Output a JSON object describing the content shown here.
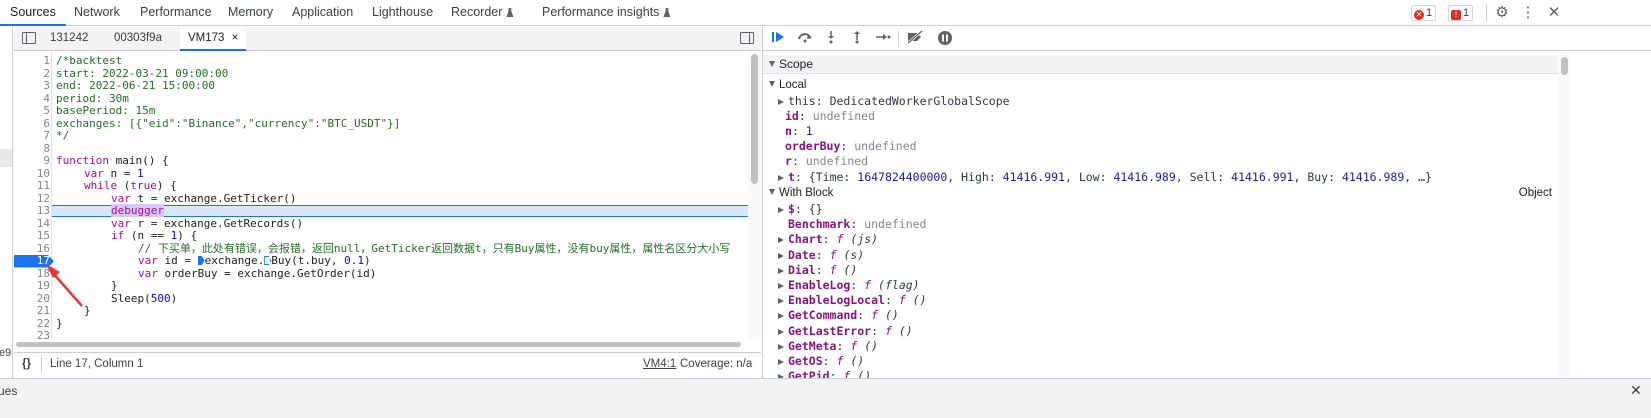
{
  "top_tabs": [
    {
      "label": "Sources",
      "active": true
    },
    {
      "label": "Network",
      "active": false
    },
    {
      "label": "Performance",
      "active": false
    },
    {
      "label": "Memory",
      "active": false
    },
    {
      "label": "Application",
      "active": false
    },
    {
      "label": "Lighthouse",
      "active": false
    },
    {
      "label": "Recorder",
      "active": false,
      "icon": "flask-icon"
    },
    {
      "label": "Performance insights",
      "active": false,
      "icon": "flask-icon"
    }
  ],
  "badges": {
    "errors": "1",
    "issues": "1"
  },
  "file_tabs": [
    {
      "label": "131242"
    },
    {
      "label": "00303f9a"
    },
    {
      "label": "VM173",
      "active": true,
      "close": "×"
    }
  ],
  "code_lines": [
    {
      "n": "1"
    },
    {
      "n": "2"
    },
    {
      "n": "3"
    },
    {
      "n": "4"
    },
    {
      "n": "5"
    },
    {
      "n": "6"
    },
    {
      "n": "7"
    },
    {
      "n": "8"
    },
    {
      "n": "9"
    },
    {
      "n": "10"
    },
    {
      "n": "11"
    },
    {
      "n": "12"
    },
    {
      "n": "13"
    },
    {
      "n": "14"
    },
    {
      "n": "15"
    },
    {
      "n": "16"
    },
    {
      "n": "17"
    },
    {
      "n": "18"
    },
    {
      "n": "19"
    },
    {
      "n": "20"
    },
    {
      "n": "21"
    },
    {
      "n": "22"
    },
    {
      "n": "23"
    }
  ],
  "code": {
    "l1": "/*backtest",
    "l2": "start: 2022-03-21 09:00:00",
    "l3": "end: 2022-06-21 15:00:00",
    "l4": "period: 30m",
    "l5": "basePeriod: 15m",
    "l6": "exchanges: [{\"eid\":\"Binance\",\"currency\":\"BTC_USDT\"}]",
    "l7": "*/",
    "l9_kw": "function",
    "l9_rest": " main() {",
    "l10_kw": "var",
    "l10_rest": " n = ",
    "l10_num": "1",
    "l11_kw": "while",
    "l11_a": " (",
    "l11_kw2": "true",
    "l11_b": ") {",
    "l12_kw": "var",
    "l12_rest": " t = exchange.GetTicker()",
    "l13": "debugger",
    "l14_kw": "var",
    "l14_rest": " r = exchange.GetRecords()",
    "l15_kw": "if",
    "l15_a": " (n == ",
    "l15_num": "1",
    "l15_b": ") {",
    "l16": "// 下买单，此处有错误，会报错，返回null，GetTicker返回数据t，只有Buy属性，没有buy属性，属性名区分大小写",
    "l17_kw": "var",
    "l17_a": " id = ",
    "l17_b": "exchange.",
    "l17_c": "Buy(t.buy, ",
    "l17_num": "0.1",
    "l17_d": ")",
    "l18_kw": "var",
    "l18_rest": " orderBuy = exchange.GetOrder(id)",
    "l19": "}",
    "l20_a": "Sleep(",
    "l20_num": "500",
    "l20_b": ")",
    "l21": "}",
    "l22": "}"
  },
  "status": {
    "braces": "{}",
    "position": "Line 17, Column 1",
    "vm_link": "VM4:1",
    "coverage": "Coverage: n/a"
  },
  "scope": {
    "header": "Scope",
    "local_label": "Local",
    "local": [
      {
        "k": "this",
        "v": "DedicatedWorkerGlobalScope"
      },
      {
        "k": "id",
        "v": "undefined"
      },
      {
        "k": "n",
        "v": "1"
      },
      {
        "k": "orderBuy",
        "v": "undefined"
      },
      {
        "k": "r",
        "v": "undefined"
      },
      {
        "k": "t",
        "v_open": "{Time: ",
        "time": "1647824400000",
        "high_k": ", High: ",
        "high": "41416.991",
        "low_k": ", Low: ",
        "low": "41416.989",
        "sell_k": ", Sell: ",
        "sell": "41416.991",
        "buy_k": ", Buy: ",
        "buy": "41416.989",
        "tail": ", …}"
      }
    ],
    "with_label": "With Block",
    "with_type": "Object",
    "with": [
      {
        "k": "$",
        "v": "{}"
      },
      {
        "k": "Benchmark",
        "v": "undefined"
      },
      {
        "k": "Chart",
        "f": "f",
        "a": "(js)"
      },
      {
        "k": "Date",
        "f": "f",
        "a": "(s)"
      },
      {
        "k": "Dial",
        "f": "f",
        "a": "()"
      },
      {
        "k": "EnableLog",
        "f": "f",
        "a": "(flag)"
      },
      {
        "k": "EnableLogLocal",
        "f": "f",
        "a": "()"
      },
      {
        "k": "GetCommand",
        "f": "f",
        "a": "()"
      },
      {
        "k": "GetLastError",
        "f": "f",
        "a": "()"
      },
      {
        "k": "GetMeta",
        "f": "f",
        "a": "()"
      },
      {
        "k": "GetOS",
        "f": "f",
        "a": "()"
      },
      {
        "k": "GetPid",
        "f": "f",
        "a": "()"
      }
    ]
  },
  "left_fragment": "e9",
  "drawer": {
    "label": "ues",
    "close": "✕"
  }
}
